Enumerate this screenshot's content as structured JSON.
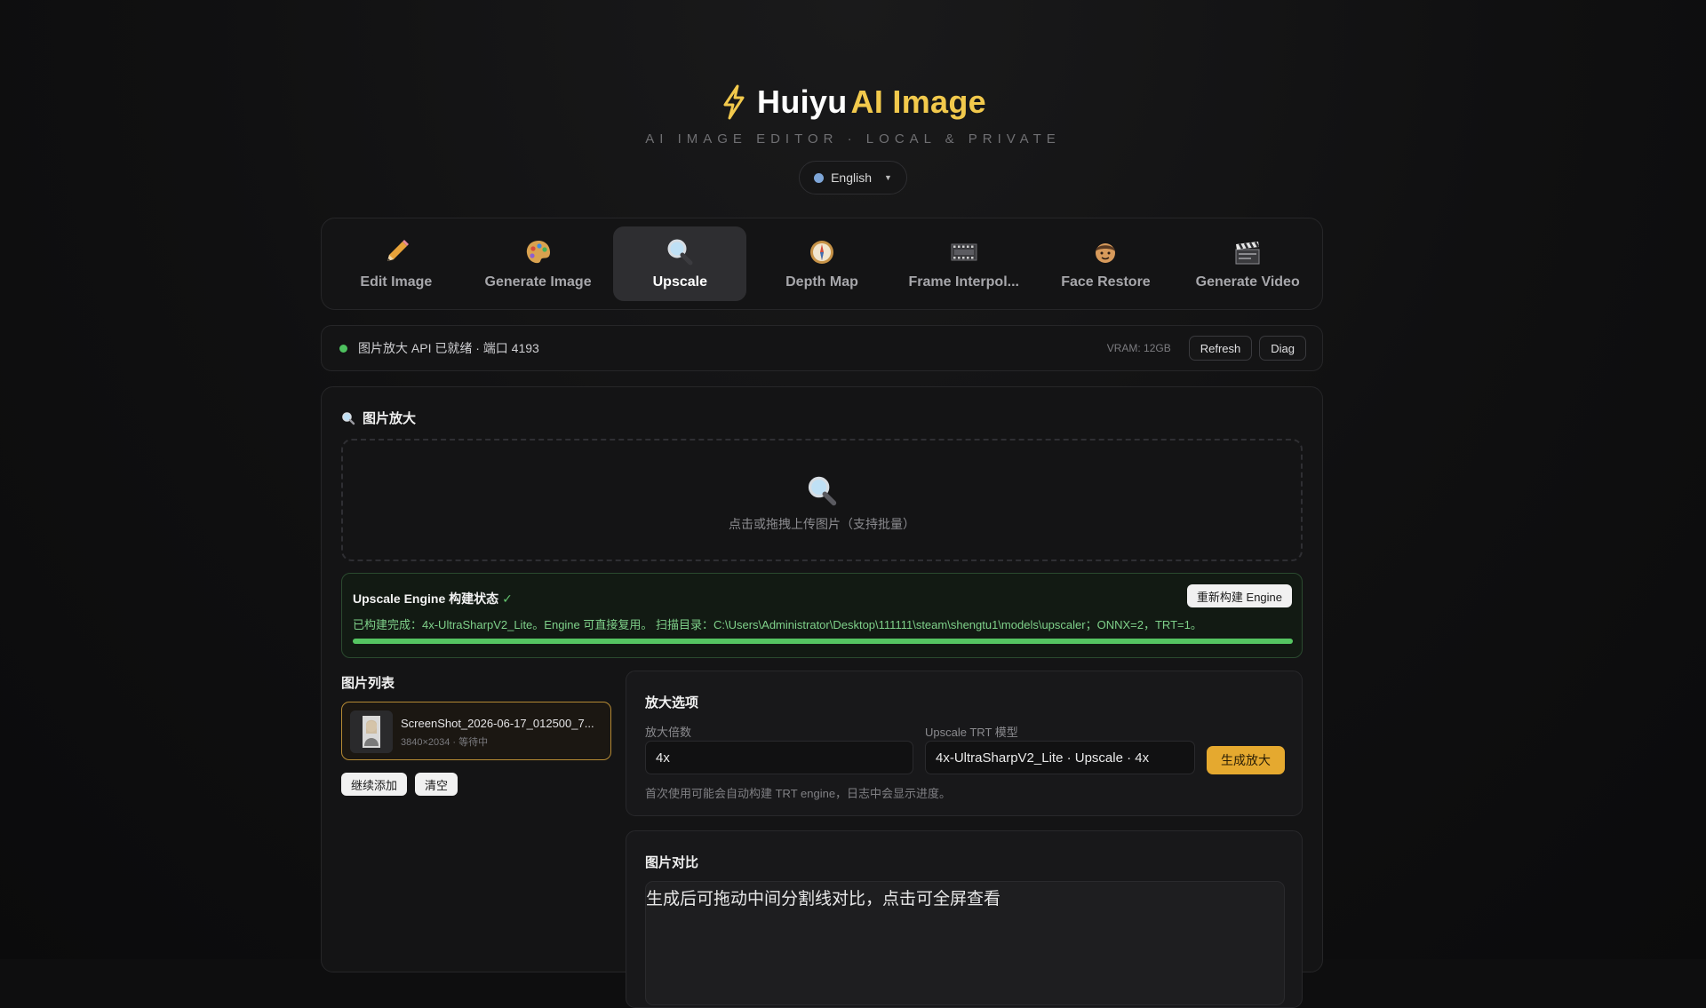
{
  "header": {
    "title_white": "Huiyu",
    "title_yellow": "AI Image",
    "subtitle": "AI IMAGE EDITOR · LOCAL & PRIVATE",
    "language": "English"
  },
  "tabs": [
    {
      "label": "Edit Image",
      "icon": "pencil-icon"
    },
    {
      "label": "Generate Image",
      "icon": "palette-icon"
    },
    {
      "label": "Upscale",
      "icon": "magnifier-icon",
      "active": true
    },
    {
      "label": "Depth Map",
      "icon": "compass-icon"
    },
    {
      "label": "Frame Interpol...",
      "icon": "film-strip-icon"
    },
    {
      "label": "Face Restore",
      "icon": "face-icon"
    },
    {
      "label": "Generate Video",
      "icon": "clapperboard-icon"
    }
  ],
  "status": {
    "text": "图片放大 API 已就绪 · 端口 4193",
    "vram": "VRAM: 12GB",
    "refresh": "Refresh",
    "diag": "Diag"
  },
  "panel": {
    "title": "图片放大",
    "dropzone_hint": "点击或拖拽上传图片（支持批量）"
  },
  "engine": {
    "title": "Upscale Engine 构建状态",
    "check": "✓",
    "rebuild": "重新构建 Engine",
    "message": "已构建完成：4x-UltraSharpV2_Lite。Engine 可直接复用。 扫描目录：C:\\Users\\Administrator\\Desktop\\111111\\steam\\shengtu1\\models\\upscaler；ONNX=2，TRT=1。",
    "progress": 1.0
  },
  "image_list": {
    "title": "图片列表",
    "items": [
      {
        "name": "ScreenShot_2026-06-17_012500_7...",
        "meta": "3840×2034 · 等待中"
      }
    ],
    "add_more": "继续添加",
    "clear": "清空"
  },
  "options": {
    "title": "放大选项",
    "scale_label": "放大倍数",
    "scale_value": "4x",
    "model_label": "Upscale TRT 模型",
    "model_value": "4x-UltraSharpV2_Lite · Upscale · 4x",
    "generate": "生成放大",
    "note": "首次使用可能会自动构建 TRT engine，日志中会显示进度。"
  },
  "compare": {
    "title": "图片对比",
    "placeholder": "生成后可拖动中间分割线对比，点击可全屏查看"
  },
  "colors": {
    "accent_yellow": "#f2c94c",
    "button_orange": "#e5a92f",
    "status_green": "#4ec15f"
  }
}
